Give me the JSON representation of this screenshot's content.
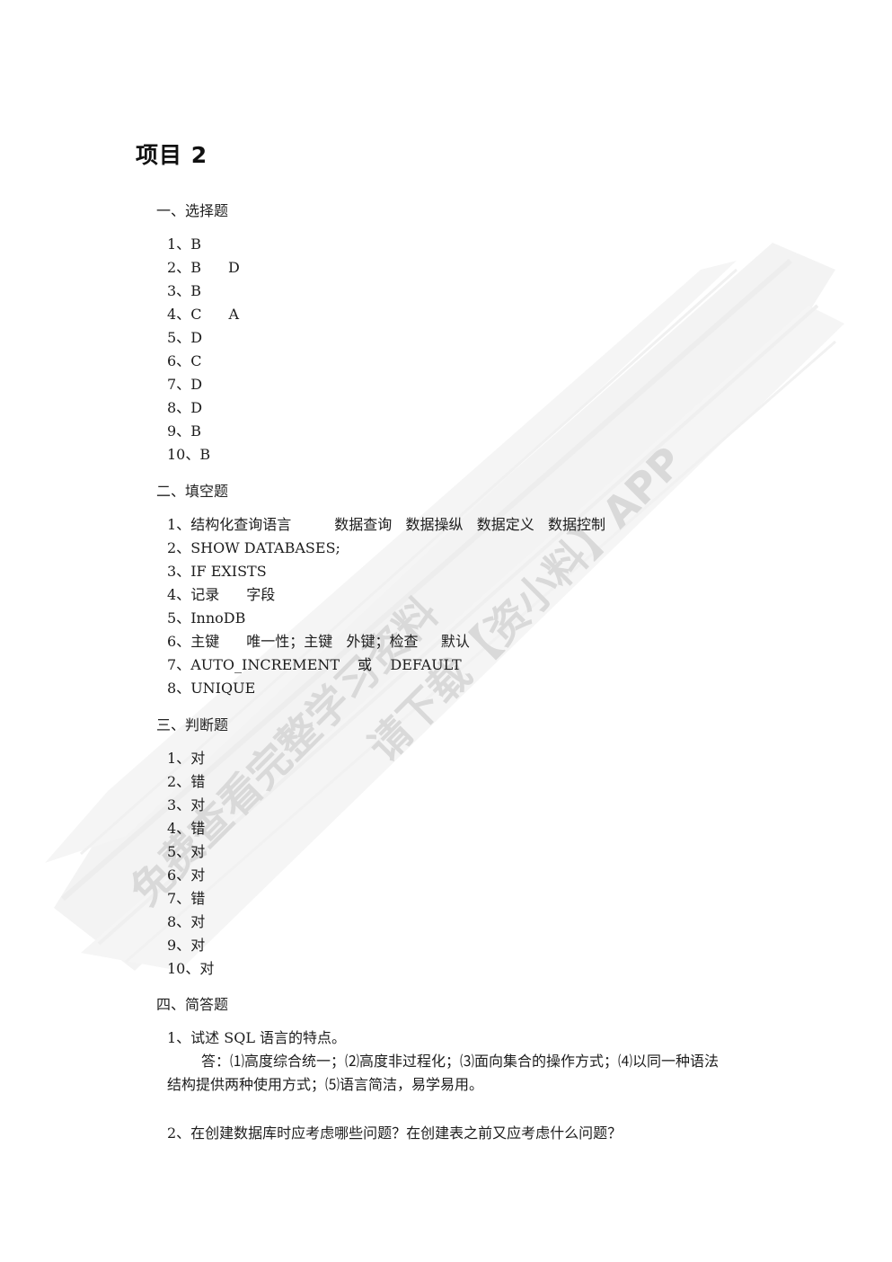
{
  "document": {
    "title": "项目 2",
    "sections": {
      "choice": {
        "heading": "一、选择题",
        "items": [
          {
            "num": "1、",
            "answers": [
              "B"
            ]
          },
          {
            "num": "2、",
            "answers": [
              "B",
              "D"
            ]
          },
          {
            "num": "3、",
            "answers": [
              "B"
            ]
          },
          {
            "num": "4、",
            "answers": [
              "C",
              "A"
            ]
          },
          {
            "num": "5、",
            "answers": [
              "D"
            ]
          },
          {
            "num": "6、",
            "answers": [
              "C"
            ]
          },
          {
            "num": "7、",
            "answers": [
              "D"
            ]
          },
          {
            "num": "8、",
            "answers": [
              "D"
            ]
          },
          {
            "num": "9、",
            "answers": [
              "B"
            ]
          },
          {
            "num": "10、",
            "answers": [
              "B"
            ]
          }
        ]
      },
      "fill": {
        "heading": "二、填空题",
        "items": [
          {
            "num": "1、",
            "text": "结构化查询语言",
            "extra": "数据查询   数据操纵   数据定义   数据控制"
          },
          {
            "num": "2、",
            "text": "SHOW DATABASES;"
          },
          {
            "num": "3、",
            "text": "IF EXISTS"
          },
          {
            "num": "4、",
            "text": "记录",
            "extra": "字段"
          },
          {
            "num": "5、",
            "text": "InnoDB"
          },
          {
            "num": "6、",
            "text": "主键",
            "extra": "唯一性；主键   外键；检查     默认"
          },
          {
            "num": "7、",
            "text": "AUTO_INCREMENT",
            "extra": "或    DEFAULT"
          },
          {
            "num": "8、",
            "text": "UNIQUE"
          }
        ]
      },
      "judge": {
        "heading": "三、判断题",
        "items": [
          {
            "num": "1、",
            "answer": "对"
          },
          {
            "num": "2、",
            "answer": "错"
          },
          {
            "num": "3、",
            "answer": "对"
          },
          {
            "num": "4、",
            "answer": "错"
          },
          {
            "num": "5、",
            "answer": "对"
          },
          {
            "num": "6、",
            "answer": "对"
          },
          {
            "num": "7、",
            "answer": "错"
          },
          {
            "num": "8、",
            "answer": "对"
          },
          {
            "num": "9、",
            "answer": "对"
          },
          {
            "num": "10、",
            "answer": "对"
          }
        ]
      },
      "short": {
        "heading": "四、简答题",
        "q1": {
          "question": "1、试述 SQL 语言的特点。",
          "answer_line1": "答：⑴高度综合统一；⑵高度非过程化；⑶面向集合的操作方式；⑷以同一种语法",
          "answer_line2": "结构提供两种使用方式；⑸语言简洁，易学易用。"
        },
        "q2": {
          "question": "2、在创建数据库时应考虑哪些问题？在创建表之前又应考虑什么问题？"
        }
      }
    }
  },
  "watermark": {
    "line1": "免费查看完整学习资料",
    "line2": "请下载【资小料】APP",
    "color": "#d9d9d9",
    "band_color": "#efefef"
  }
}
